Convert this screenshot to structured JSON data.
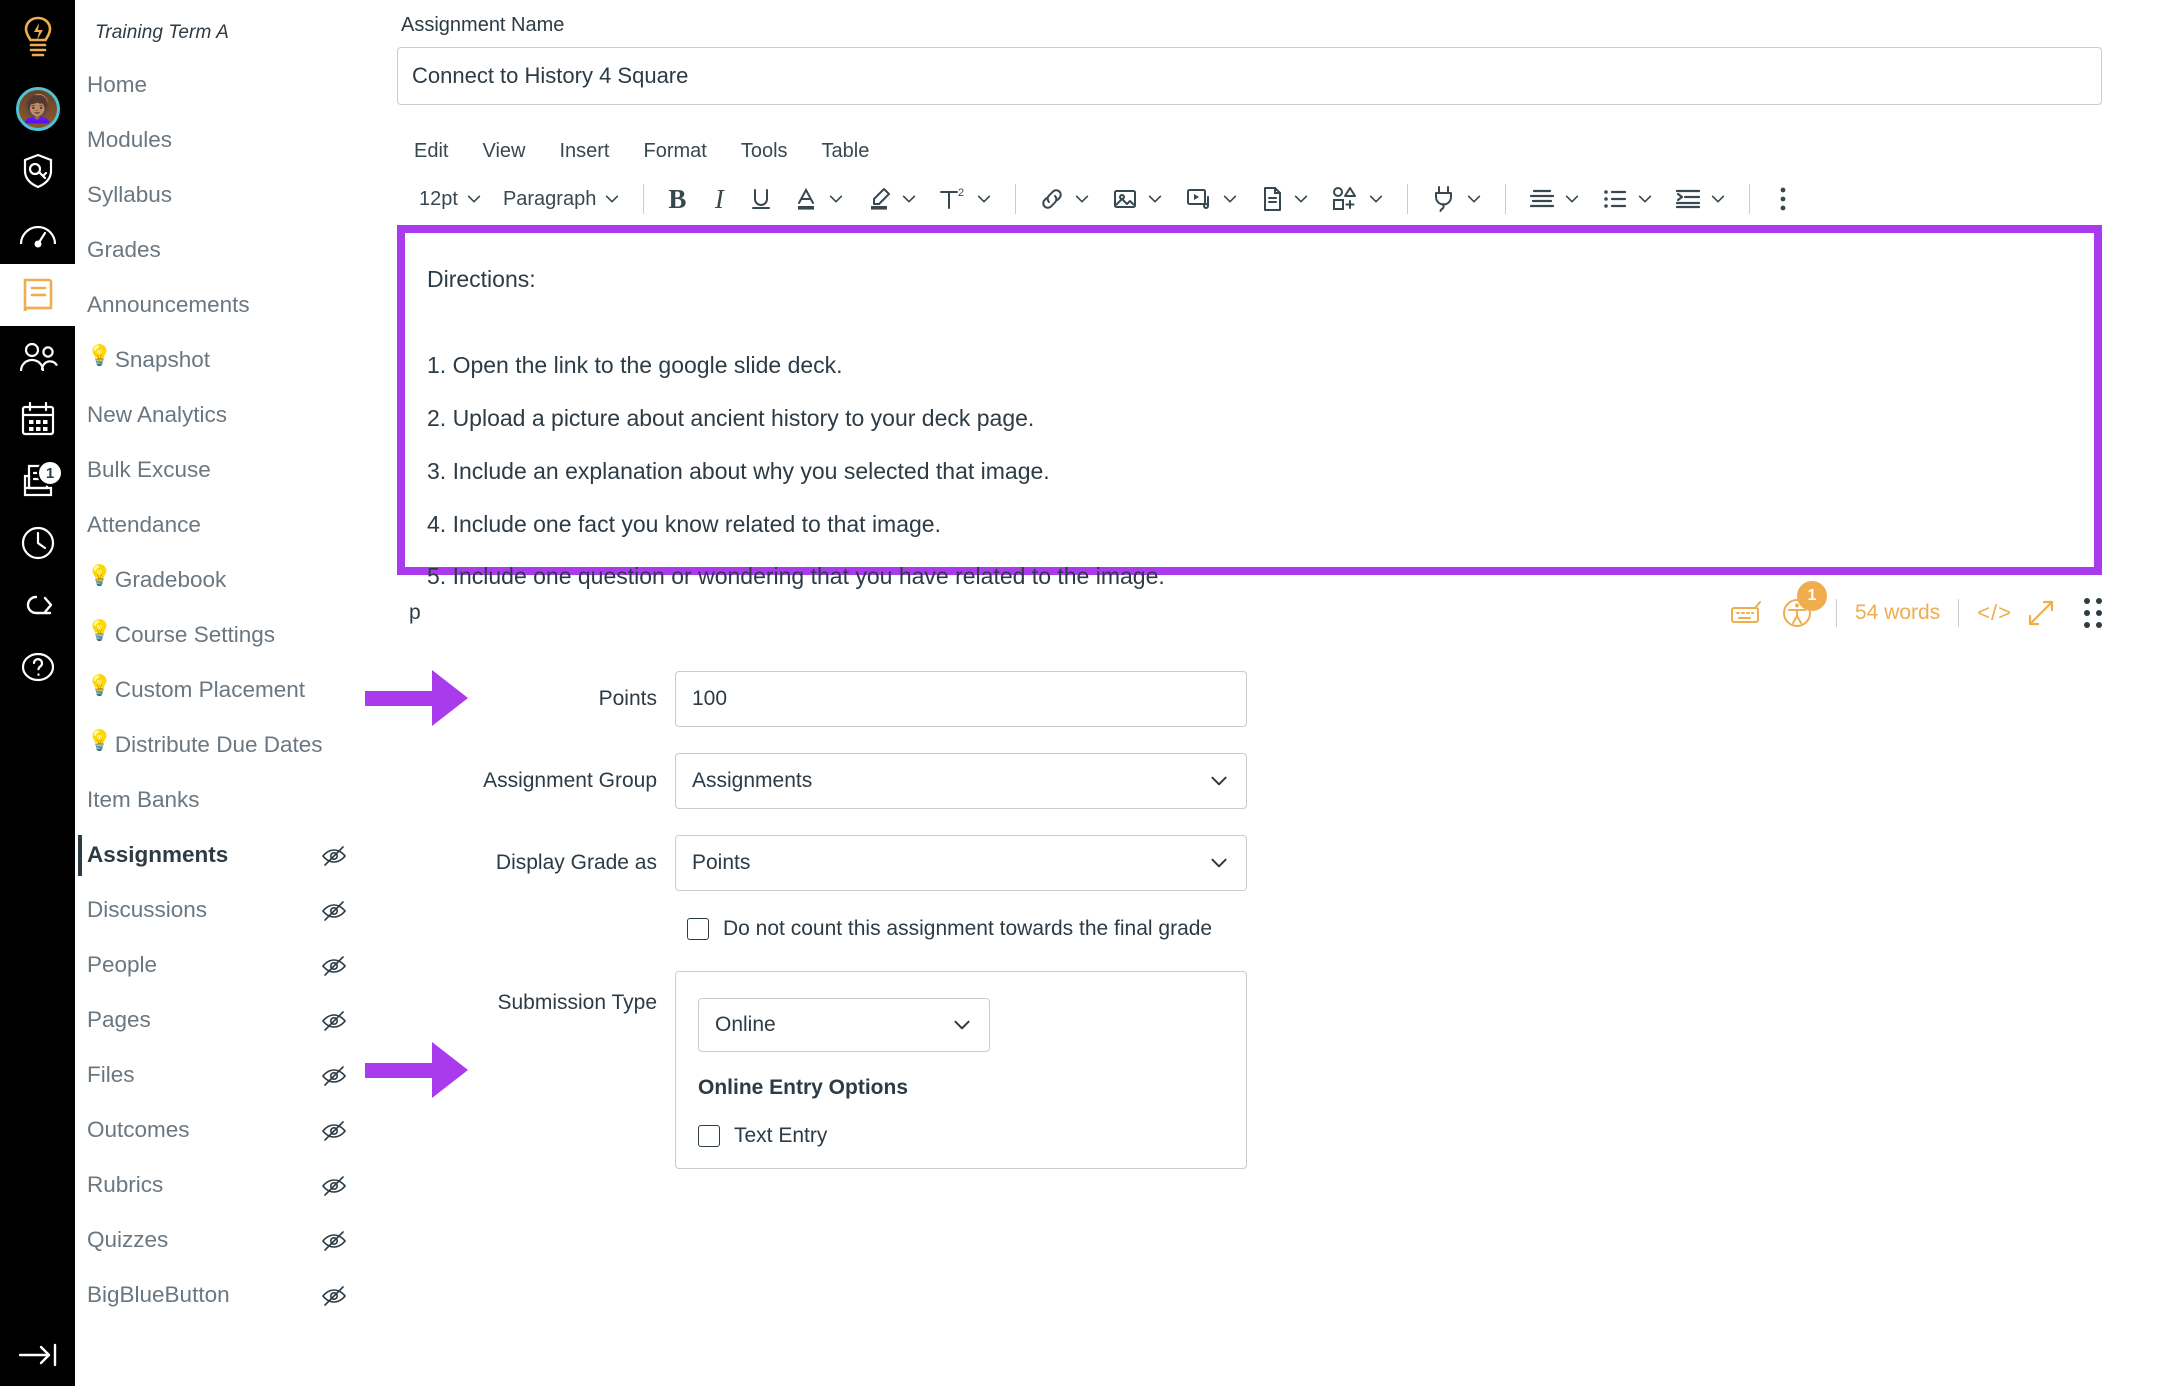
{
  "global_rail": {
    "items": [
      {
        "name": "dashboard-logo-icon",
        "badge": null
      },
      {
        "name": "account-avatar",
        "badge": null
      },
      {
        "name": "admin-shield-icon",
        "badge": null
      },
      {
        "name": "dashboard-gauge-icon",
        "badge": null
      },
      {
        "name": "courses-book-icon",
        "badge": null,
        "active": true
      },
      {
        "name": "groups-people-icon",
        "badge": null
      },
      {
        "name": "calendar-icon",
        "badge": null
      },
      {
        "name": "inbox-icon",
        "badge": "1"
      },
      {
        "name": "history-clock-icon",
        "badge": null
      },
      {
        "name": "commons-export-icon",
        "badge": null
      },
      {
        "name": "help-question-icon",
        "badge": null
      }
    ],
    "collapse_label": "collapse-nav-icon"
  },
  "course_nav": {
    "term": "Training Term A",
    "items": [
      {
        "label": "Home",
        "bulb": false,
        "hidden_icon": false,
        "active": false
      },
      {
        "label": "Modules",
        "bulb": false,
        "hidden_icon": false,
        "active": false
      },
      {
        "label": "Syllabus",
        "bulb": false,
        "hidden_icon": false,
        "active": false
      },
      {
        "label": "Grades",
        "bulb": false,
        "hidden_icon": false,
        "active": false
      },
      {
        "label": "Announcements",
        "bulb": false,
        "hidden_icon": false,
        "active": false
      },
      {
        "label": "Snapshot",
        "bulb": true,
        "hidden_icon": false,
        "active": false
      },
      {
        "label": "New Analytics",
        "bulb": false,
        "hidden_icon": false,
        "active": false
      },
      {
        "label": "Bulk Excuse",
        "bulb": false,
        "hidden_icon": false,
        "active": false
      },
      {
        "label": "Attendance",
        "bulb": false,
        "hidden_icon": false,
        "active": false
      },
      {
        "label": "Gradebook",
        "bulb": true,
        "hidden_icon": false,
        "active": false
      },
      {
        "label": "Course Settings",
        "bulb": true,
        "hidden_icon": false,
        "active": false
      },
      {
        "label": "Custom Placement",
        "bulb": true,
        "hidden_icon": false,
        "active": false
      },
      {
        "label": "Distribute Due Dates",
        "bulb": true,
        "hidden_icon": false,
        "active": false
      },
      {
        "label": "Item Banks",
        "bulb": false,
        "hidden_icon": false,
        "active": false
      },
      {
        "label": "Assignments",
        "bulb": false,
        "hidden_icon": true,
        "active": true
      },
      {
        "label": "Discussions",
        "bulb": false,
        "hidden_icon": true,
        "active": false
      },
      {
        "label": "People",
        "bulb": false,
        "hidden_icon": true,
        "active": false
      },
      {
        "label": "Pages",
        "bulb": false,
        "hidden_icon": true,
        "active": false
      },
      {
        "label": "Files",
        "bulb": false,
        "hidden_icon": true,
        "active": false
      },
      {
        "label": "Outcomes",
        "bulb": false,
        "hidden_icon": true,
        "active": false
      },
      {
        "label": "Rubrics",
        "bulb": false,
        "hidden_icon": true,
        "active": false
      },
      {
        "label": "Quizzes",
        "bulb": false,
        "hidden_icon": true,
        "active": false
      },
      {
        "label": "BigBlueButton",
        "bulb": false,
        "hidden_icon": true,
        "active": false
      }
    ]
  },
  "assignment": {
    "name_label": "Assignment Name",
    "name_value": "Connect to History 4 Square"
  },
  "editor": {
    "menus": [
      "Edit",
      "View",
      "Insert",
      "Format",
      "Tools",
      "Table"
    ],
    "font_size": "12pt",
    "block_format": "Paragraph",
    "content": {
      "heading": "Directions:",
      "steps": [
        "1. Open the link to the google slide deck.",
        "2. Upload a picture about ancient history to your deck page.",
        "3. Include an explanation about why you selected that image.",
        "4. Include one fact you know related to that image.",
        "5. Include one question or wondering that you have related to the image."
      ]
    },
    "status": {
      "element_path": "p",
      "word_count": "54 words",
      "a11y_issue_count": "1",
      "html_editor_label": "</>"
    },
    "highlight_color": "#a93bed"
  },
  "form": {
    "points": {
      "label": "Points",
      "value": "100"
    },
    "assignment_group": {
      "label": "Assignment Group",
      "value": "Assignments"
    },
    "display_grade_as": {
      "label": "Display Grade as",
      "value": "Points"
    },
    "omit_from_final": {
      "label": "Do not count this assignment towards the final grade",
      "checked": false
    },
    "submission_type": {
      "label": "Submission Type",
      "value": "Online",
      "online_entry_heading": "Online Entry Options",
      "options": [
        {
          "label": "Text Entry",
          "checked": false
        }
      ]
    }
  },
  "annotations": {
    "accent_color": "#a93bed"
  }
}
